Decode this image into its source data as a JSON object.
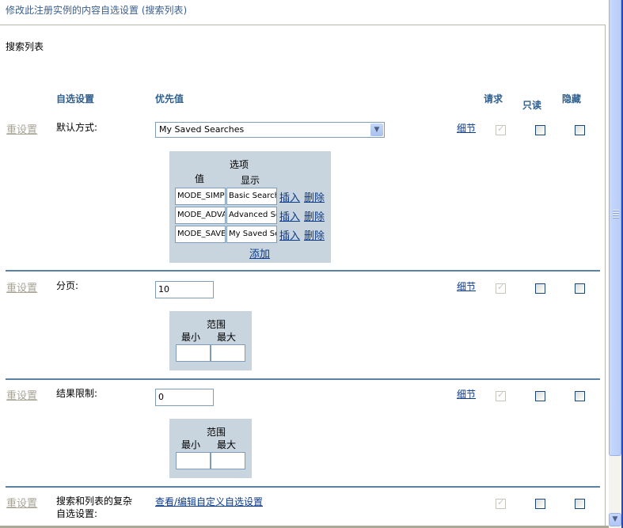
{
  "page": {
    "title": "修改此注册实例的内容自选设置 (搜索列表)",
    "section_title": "搜索列表"
  },
  "headers": {
    "setting": "自选设置",
    "value": "优先值",
    "required": "请求",
    "readonly": "只读",
    "hidden": "隐藏"
  },
  "rows": [
    {
      "reset": "重设置",
      "label": "默认方式:",
      "select_value": "My Saved Searches",
      "detail": "细节",
      "required": true,
      "readonly": false,
      "hidden": false,
      "options_panel": {
        "title": "选项",
        "col_value": "值",
        "col_display": "显示",
        "items": [
          {
            "value": "MODE_SIMP",
            "display": "Basic Search",
            "insert": "插入",
            "delete": "删除"
          },
          {
            "value": "MODE_ADVA",
            "display": "Advanced Se",
            "insert": "插入",
            "delete": "删除"
          },
          {
            "value": "MODE_SAVE",
            "display": "My Saved Se",
            "insert": "插入",
            "delete": "删除"
          }
        ],
        "add": "添加"
      }
    },
    {
      "reset": "重设置",
      "label": "分页:",
      "input_value": "10",
      "detail": "细节",
      "required": true,
      "readonly": false,
      "hidden": false,
      "range": {
        "title": "范围",
        "min_label": "最小",
        "max_label": "最大",
        "min": "",
        "max": ""
      }
    },
    {
      "reset": "重设置",
      "label": "结果限制:",
      "input_value": "0",
      "detail": "细节",
      "required": true,
      "readonly": false,
      "hidden": false,
      "range": {
        "title": "范围",
        "min_label": "最小",
        "max_label": "最大",
        "min": "",
        "max": ""
      }
    },
    {
      "reset": "重设置",
      "label_line1": "搜索和列表的复杂",
      "label_line2": "自选设置:",
      "link": "查看/编辑自定义自选设置",
      "required": true,
      "readonly": false,
      "hidden": false
    }
  ]
}
